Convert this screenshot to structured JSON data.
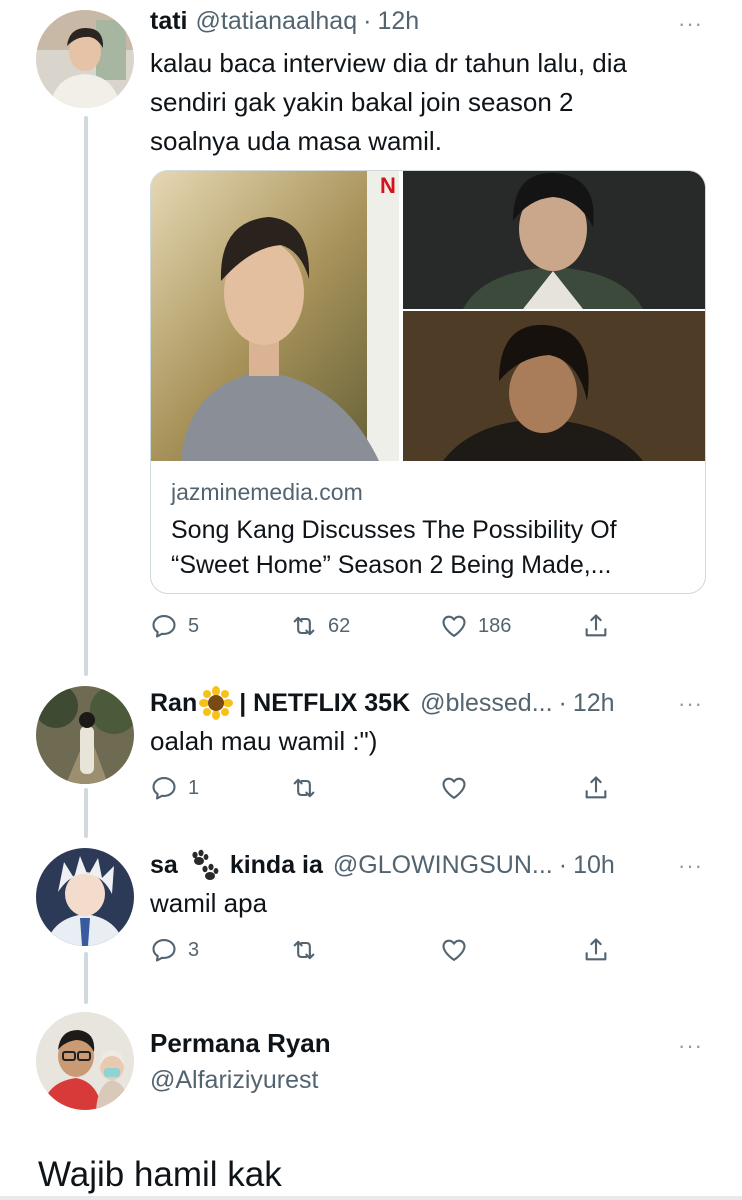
{
  "tweets": [
    {
      "name": "tati",
      "handle": "@tatianaalhaq",
      "separator": "·",
      "time": "12h",
      "text_lines": [
        "kalau baca interview dia dr tahun lalu, dia",
        "sendiri gak yakin bakal join season 2",
        "soalnya uda masa wamil."
      ],
      "card": {
        "domain": "jazminemedia.com",
        "title_lines": [
          "Song Kang Discusses The Possibility Of",
          "“Sweet Home” Season 2 Being Made,..."
        ],
        "badge": "N"
      },
      "reply_count": "5",
      "retweet_count": "62",
      "like_count": "186"
    },
    {
      "name_part1": "Ran",
      "name_part2": "| NETFLIX 35K",
      "handle": "@blessed...",
      "separator": "·",
      "time": "12h",
      "text": "oalah mau wamil :\")",
      "reply_count": "1",
      "emoji_icon": "sunflower-emoji"
    },
    {
      "name_part1": "sa",
      "name_part2": "kinda ia",
      "handle": "@GLOWINGSUN...",
      "separator": "·",
      "time": "10h",
      "text": "wamil apa",
      "reply_count": "3",
      "emoji_icon": "paw-prints-emoji"
    }
  ],
  "main_reply": {
    "name": "Permana Ryan",
    "handle": "@Alfariziyurest",
    "text": "Wajib hamil kak"
  },
  "more_glyph": "···",
  "colors": {
    "text_primary": "#0f1419",
    "text_secondary": "#536471",
    "thread_line": "#cfd9de",
    "border": "#cfd9de"
  }
}
